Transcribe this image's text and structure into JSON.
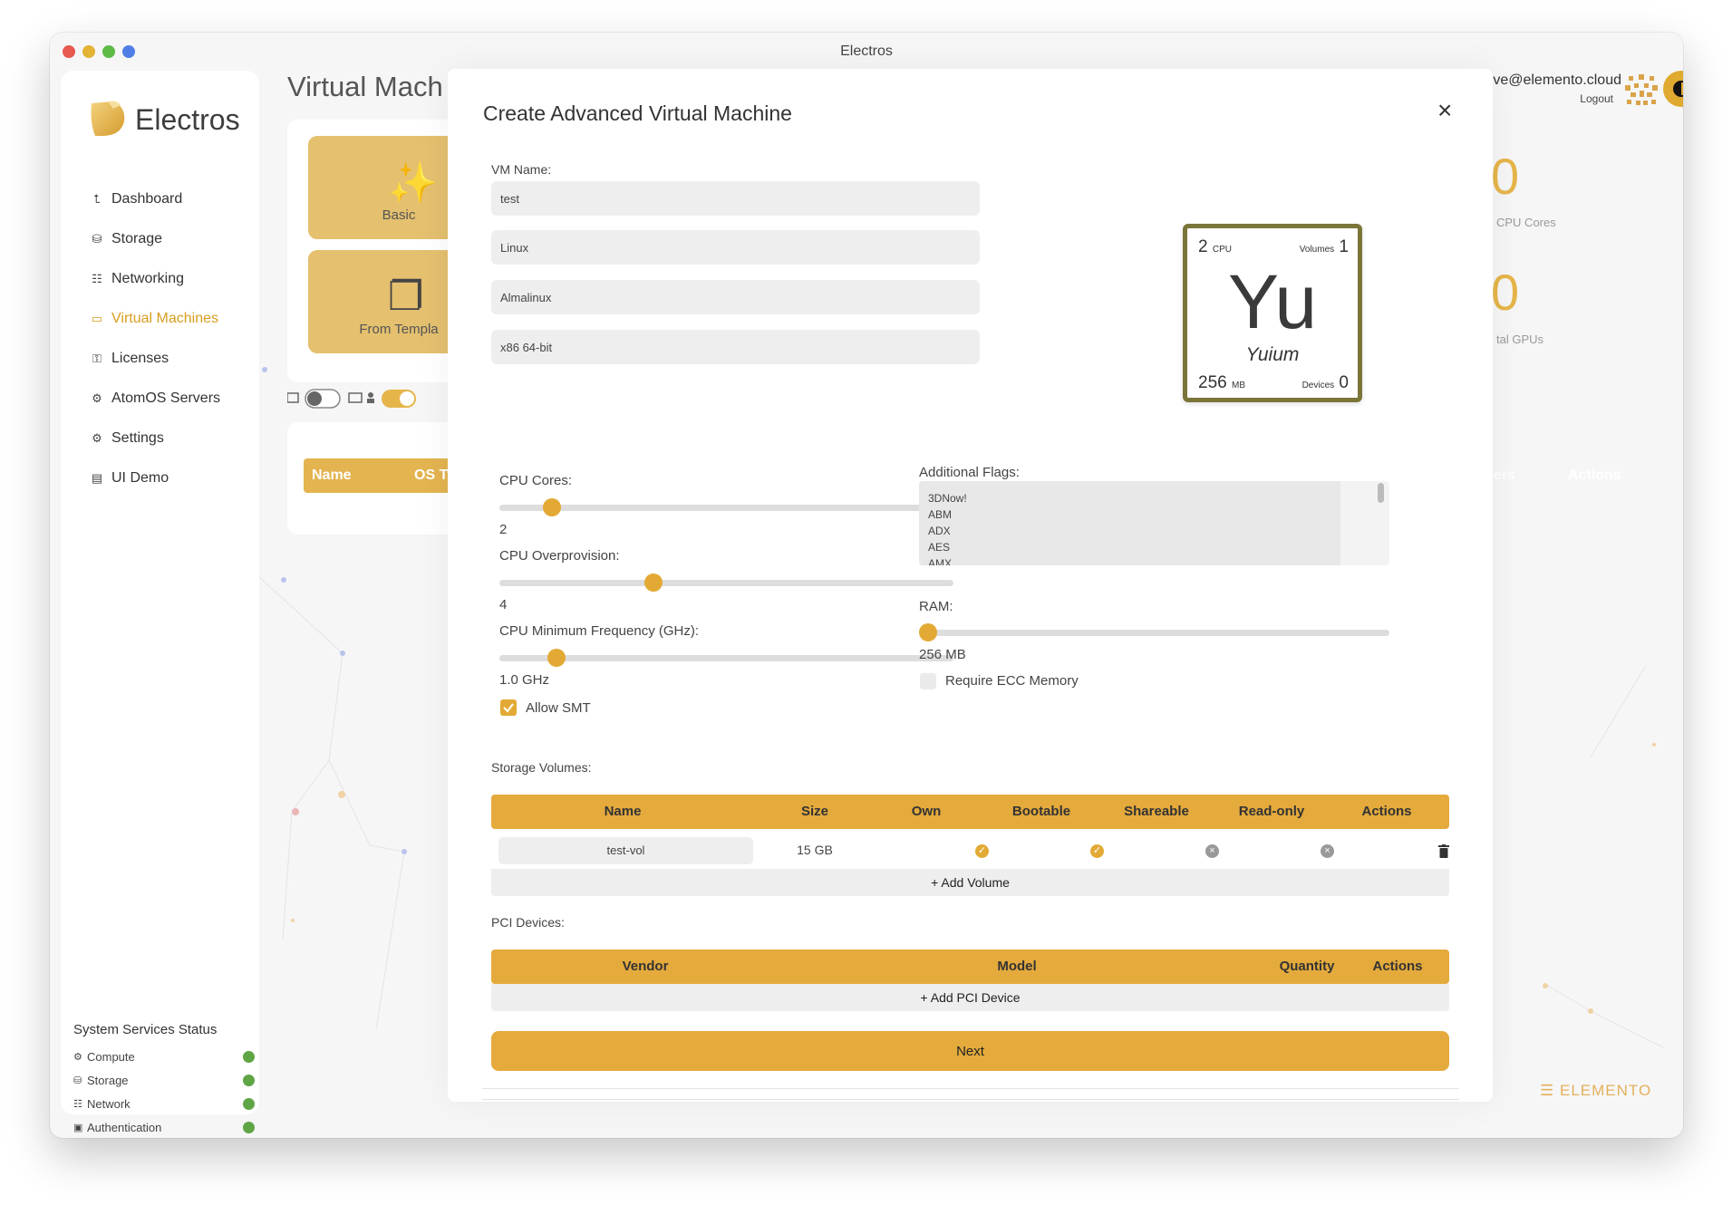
{
  "window": {
    "title": "Electros"
  },
  "sidebar": {
    "brand": "Electros",
    "items": [
      {
        "label": "Dashboard",
        "icon": "chart-icon"
      },
      {
        "label": "Storage",
        "icon": "database-icon"
      },
      {
        "label": "Networking",
        "icon": "network-icon"
      },
      {
        "label": "Virtual Machines",
        "icon": "monitor-icon"
      },
      {
        "label": "Licenses",
        "icon": "key-icon"
      },
      {
        "label": "AtomOS Servers",
        "icon": "gear-icon"
      },
      {
        "label": "Settings",
        "icon": "cog-icon"
      },
      {
        "label": "UI Demo",
        "icon": "window-icon"
      }
    ],
    "services": {
      "title": "System Services Status",
      "items": [
        {
          "label": "Compute",
          "status": "ok"
        },
        {
          "label": "Storage",
          "status": "ok"
        },
        {
          "label": "Network",
          "status": "ok"
        },
        {
          "label": "Authentication",
          "status": "ok"
        }
      ]
    }
  },
  "main": {
    "title": "Virtual Mach",
    "tiles": [
      "Basic",
      "From Templa"
    ],
    "stats": [
      {
        "value": "0",
        "label": "CPU Cores"
      },
      {
        "value": "0",
        "label": "tal GPUs"
      }
    ],
    "table_headers": [
      "Name",
      "OS Ty",
      "ers",
      "Actions"
    ]
  },
  "user": {
    "email": "testdrive@elemento.cloud",
    "logout": "Logout"
  },
  "watermark": "ELEMENTO",
  "modal": {
    "title": "Create Advanced Virtual Machine",
    "vm_name_label": "VM Name:",
    "vm_name": "test",
    "os_family": "Linux",
    "os_flavour": "Almalinux",
    "arch": "x86 64-bit",
    "element": {
      "cpu": "2",
      "cpu_unit": "CPU",
      "volumes_label": "Volumes",
      "volumes": "1",
      "symbol": "Yu",
      "name": "Yuium",
      "ram": "256",
      "ram_unit": "MB",
      "devices_label": "Devices",
      "devices": "0"
    },
    "cpu_cores": {
      "label": "CPU Cores:",
      "value": "2",
      "fraction": 0.115
    },
    "cpu_overprovision": {
      "label": "CPU Overprovision:",
      "value": "4",
      "fraction": 0.34
    },
    "cpu_min_freq": {
      "label": "CPU Minimum Frequency (GHz):",
      "value": "1.0 GHz",
      "fraction": 0.125
    },
    "allow_smt": {
      "label": "Allow SMT",
      "checked": true
    },
    "flags": {
      "label": "Additional Flags:",
      "options": [
        "3DNow!",
        "ABM",
        "ADX",
        "AES",
        "AMX"
      ]
    },
    "ram": {
      "label": "RAM:",
      "value": "256 MB",
      "fraction": 0.0
    },
    "ecc": {
      "label": "Require ECC Memory",
      "checked": false
    },
    "storage": {
      "label": "Storage Volumes:",
      "headers": [
        "Name",
        "Size",
        "Own",
        "Bootable",
        "Shareable",
        "Read-only",
        "Actions"
      ],
      "rows": [
        {
          "name": "test-vol",
          "size": "15 GB",
          "own": true,
          "bootable": true,
          "shareable": false,
          "readonly": false
        }
      ],
      "add_label": "Add Volume"
    },
    "pci": {
      "label": "PCI Devices:",
      "headers": [
        "Vendor",
        "Model",
        "Quantity",
        "Actions"
      ],
      "add_label": "Add PCI Device"
    },
    "next_label": "Next"
  },
  "colors": {
    "accent": "#e2aa35",
    "header": "#e4aa3c",
    "element_border": "#7a7539",
    "status_ok": "#5fa545"
  }
}
